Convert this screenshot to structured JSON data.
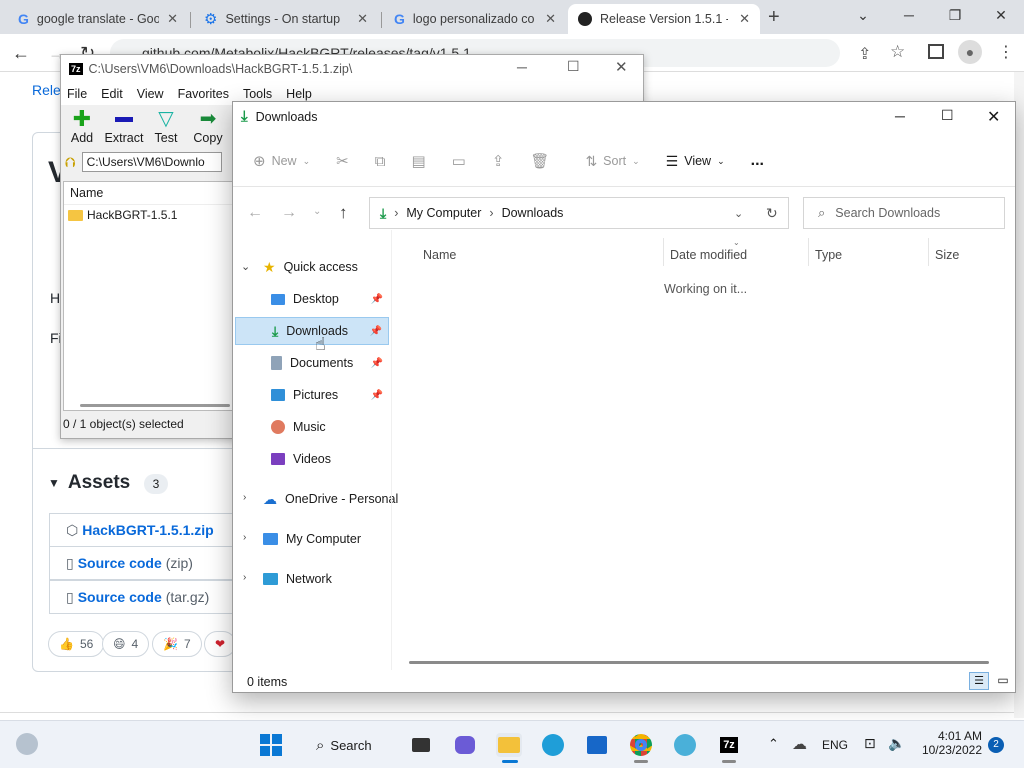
{
  "chrome": {
    "tabs": [
      {
        "title": "google translate - Goo",
        "icon": "google-icon"
      },
      {
        "title": "Settings - On startup",
        "icon": "gear-icon"
      },
      {
        "title": "logo personalizado co",
        "icon": "google-icon"
      },
      {
        "title": "Release Version 1.5.1 -",
        "icon": "github-icon"
      }
    ],
    "url": "github.com/Metabolix/HackBGRT/releases/tag/v1.5.1",
    "new_tab": "+"
  },
  "github": {
    "breadcrumb": "Rele",
    "heading_char": "V",
    "text1": "H",
    "text2": "Fi",
    "assets_label": "Assets",
    "assets_count": "3",
    "assets": [
      {
        "name": "HackBGRT-1.5.1.zip",
        "icon": "package-icon"
      },
      {
        "name": "Source code",
        "suffix": "(zip)",
        "icon": "file-zip-icon"
      },
      {
        "name": "Source code",
        "suffix": "(tar.gz)",
        "icon": "file-zip-icon"
      }
    ],
    "reactions": [
      {
        "emoji": "👍",
        "count": "56"
      },
      {
        "emoji": "😄",
        "count": "4"
      },
      {
        "emoji": "🎉",
        "count": "7"
      },
      {
        "emoji": "❤",
        "count": ""
      }
    ]
  },
  "zip": {
    "title": "C:\\Users\\VM6\\Downloads\\HackBGRT-1.5.1.zip\\",
    "menu": [
      "File",
      "Edit",
      "View",
      "Favorites",
      "Tools",
      "Help"
    ],
    "toolbar": [
      "Add",
      "Extract",
      "Test",
      "Copy"
    ],
    "path": "C:\\Users\\VM6\\Downlo",
    "col_name": "Name",
    "file": "HackBGRT-1.5.1",
    "status": "0 / 1 object(s) selected"
  },
  "explorer": {
    "title": "Downloads",
    "cmd": {
      "new": "New",
      "sort": "Sort",
      "view": "View",
      "more": "..."
    },
    "breadcrumb": [
      "My Computer",
      "Downloads"
    ],
    "search_placeholder": "Search Downloads",
    "nav": {
      "quick_access": "Quick access",
      "items": [
        "Desktop",
        "Downloads",
        "Documents",
        "Pictures",
        "Music",
        "Videos"
      ],
      "onedrive": "OneDrive - Personal",
      "computer": "My Computer",
      "network": "Network"
    },
    "columns": [
      "Name",
      "Date modified",
      "Type",
      "Size"
    ],
    "working": "Working on it...",
    "status": "0 items"
  },
  "taskbar": {
    "search": "Search",
    "lang": "ENG",
    "time": "4:01 AM",
    "date": "10/23/2022",
    "badge": "2"
  }
}
